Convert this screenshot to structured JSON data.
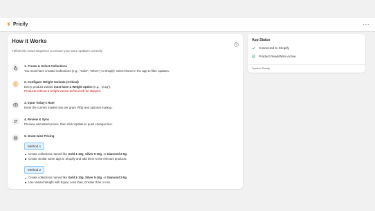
{
  "app": {
    "name": "Pricify",
    "more_label": "···"
  },
  "guide": {
    "title": "How it Works",
    "subtitle": "Follow this exact sequence to ensure your store updates correctly.",
    "steps": [
      {
        "title": "1. Create & Select Collections",
        "text": "You must have created Collections (e.g., \"Gold\", \"Silver\") in Shopify. Select these in the app to filter updates.",
        "icon": "hand-pointer-icon"
      },
      {
        "title": "2. Configure Weight Variants (Critical)",
        "text_pre": "Every product variant ",
        "text_bold": "must have a Weight option",
        "text_post": " (e.g., \"2.5g\").",
        "critical": "Products without a weight variant defined will be skipped.",
        "icon": "alert-icon"
      },
      {
        "title": "3. Input Today's Rate",
        "text": "Enter the current market rate per gram (₹/g) and optional markup.",
        "icon": "money-icon"
      },
      {
        "title": "4. Review & Sync",
        "text": "Preview calculated prices, then click Update to push changes live.",
        "icon": "sync-icon"
      },
      {
        "title": "5. Gram-wise Pricing",
        "icon": "settings-icon",
        "methods": [
          {
            "label": "Method 1",
            "bullet1_pre": "Create collections named like ",
            "b1": "Gold 1-10g",
            "s1": ", ",
            "b2": "Silver 5-10g",
            "s2": ", or ",
            "b3": "Diamond 2-5g",
            "s3": ".",
            "bullet2": "Create similar name tags in Shopify and add them to the relevant products."
          },
          {
            "label": "Method 2",
            "bullet1_pre": "Create collections named like ",
            "b1": "Gold 1-10g",
            "s1": ", ",
            "b2": "Silver 5-10g",
            "s2": ", or ",
            "b3": "Diamond 2-5g",
            "s3": ".",
            "bullet2": "Use Variant Weight with Equal, Less than, Greater than or mix."
          }
        ]
      }
    ]
  },
  "status": {
    "title": "App Status",
    "items": [
      {
        "label": "Connected to Shopify",
        "icon": "check-icon"
      },
      {
        "label": "Product Read/Write Active",
        "icon": "check-circle-icon"
      }
    ],
    "footer": "System Ready"
  },
  "colors": {
    "critical": "#c21b1b",
    "success": "#0f8a55",
    "method_badge_bg": "#e0f0ff",
    "warning_icon": "#b98900"
  }
}
